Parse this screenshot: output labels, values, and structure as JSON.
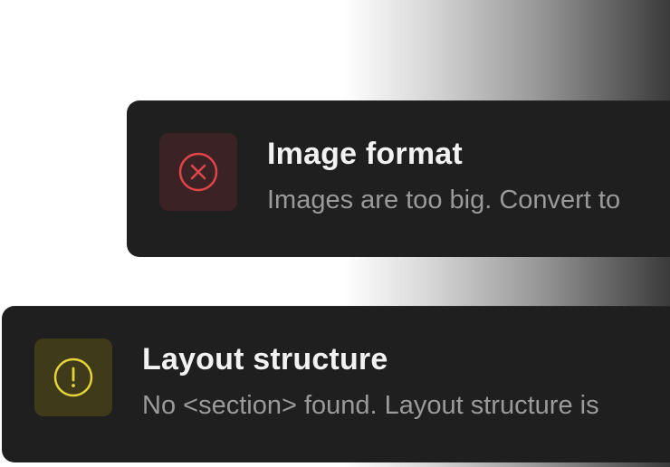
{
  "colors": {
    "error_accent": "#e0454a",
    "error_tile_bg": "#3b2224",
    "warning_accent": "#e3d43a",
    "warning_tile_bg": "#3f3b1a",
    "card_bg": "#1f1f1f",
    "title_text": "#f2f2f2",
    "desc_text": "#9a9a9a"
  },
  "notifications": [
    {
      "severity": "error",
      "icon": "x-circle-icon",
      "title": "Image format",
      "description": "Images are too big. Convert to"
    },
    {
      "severity": "warning",
      "icon": "exclamation-circle-icon",
      "title": "Layout structure",
      "description": "No <section> found. Layout structure is"
    }
  ]
}
